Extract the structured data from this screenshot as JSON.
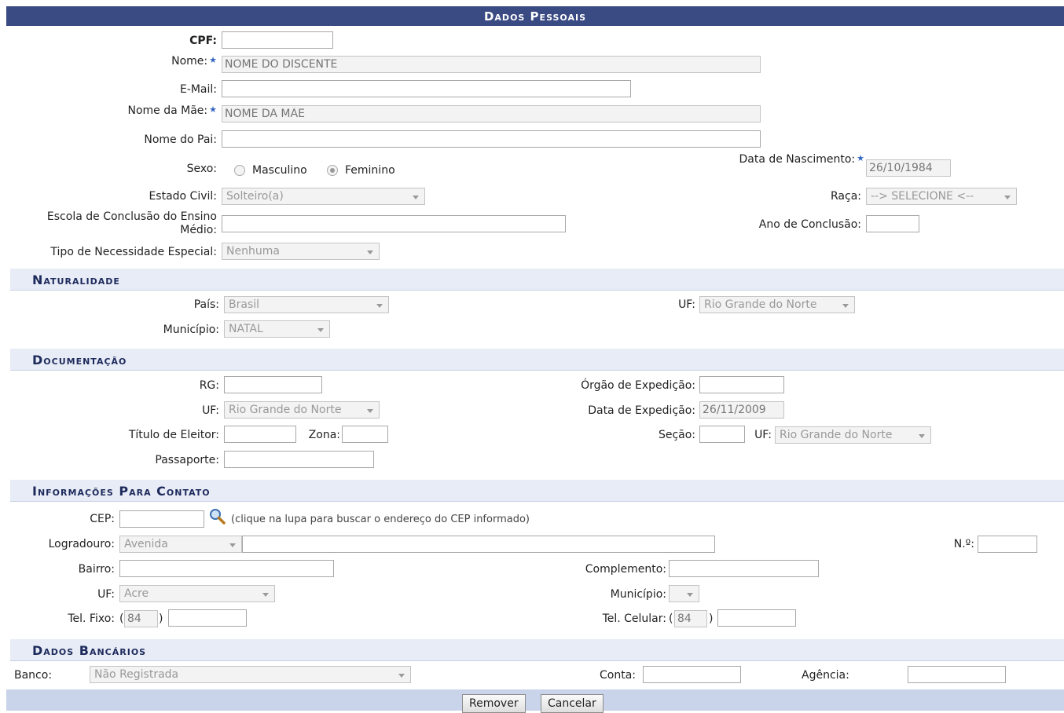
{
  "header": {
    "title": "Dados Pessoais"
  },
  "personal": {
    "cpf_label": "CPF:",
    "nome_label": "Nome:",
    "nome_placeholder": "NOME DO DISCENTE",
    "email_label": "E-Mail:",
    "mae_label": "Nome da Mãe:",
    "mae_placeholder": "NOME DA MÃE",
    "pai_label": "Nome do Pai:",
    "sexo_label": "Sexo:",
    "sexo_masculino": "Masculino",
    "sexo_feminino": "Feminino",
    "sexo_selected": "Feminino",
    "nascimento_label": "Data de Nascimento:",
    "nascimento_value": "26/10/1984",
    "estado_civil_label": "Estado Civil:",
    "estado_civil_value": "Solteiro(a)",
    "raca_label": "Raça:",
    "raca_value": "--> SELECIONE <--",
    "escola_label_1": "Escola de Conclusão do Ensino",
    "escola_label_2": "Médio:",
    "ano_conclusao_label": "Ano de Conclusão:",
    "necessidade_label": "Tipo de Necessidade Especial:",
    "necessidade_value": "Nenhuma"
  },
  "naturalidade": {
    "title": "Naturalidade",
    "pais_label": "País:",
    "pais_value": "Brasil",
    "uf_label": "UF:",
    "uf_value": "Rio Grande do Norte",
    "municipio_label": "Município:",
    "municipio_value": "NATAL"
  },
  "documentacao": {
    "title": "Documentação",
    "rg_label": "RG:",
    "orgao_label": "Órgão de Expedição:",
    "uf_label": "UF:",
    "uf_value": "Rio Grande do Norte",
    "data_expedicao_label": "Data de Expedição:",
    "data_expedicao_value": "26/11/2009",
    "titulo_label": "Título de Eleitor:",
    "zona_label": "Zona:",
    "secao_label": "Seção:",
    "uf2_label": "UF:",
    "uf2_value": "Rio Grande do Norte",
    "passaporte_label": "Passaporte:"
  },
  "contato": {
    "title": "Informações Para Contato",
    "cep_label": "CEP:",
    "cep_hint": "(clique na lupa para buscar o endereço do CEP informado)",
    "logradouro_label": "Logradouro:",
    "logradouro_tipo": "Avenida",
    "numero_label": "N.º:",
    "bairro_label": "Bairro:",
    "complemento_label": "Complemento:",
    "uf_label": "UF:",
    "uf_value": "Acre",
    "municipio_label": "Município:",
    "tel_fixo_label": "Tel. Fixo:",
    "tel_fixo_ddd": "84",
    "tel_celular_label": "Tel. Celular:",
    "tel_celular_ddd": "84",
    "paren_open": "(",
    "paren_close": ")"
  },
  "bancarios": {
    "title": "Dados Bancários",
    "banco_label": "Banco:",
    "banco_value": "Não Registrada",
    "conta_label": "Conta:",
    "agencia_label": "Agência:"
  },
  "footer": {
    "remover_label": "Remover",
    "cancelar_label": "Cancelar"
  },
  "icons": {
    "required": "star-icon",
    "cep_search": "magnifier-icon"
  },
  "colors": {
    "header_bg": "#3a4a82",
    "section_bg": "#e8ecf6",
    "section_text": "#1d2a5c",
    "footer_bg": "#c9d4ea",
    "required_star": "#3566c0"
  }
}
